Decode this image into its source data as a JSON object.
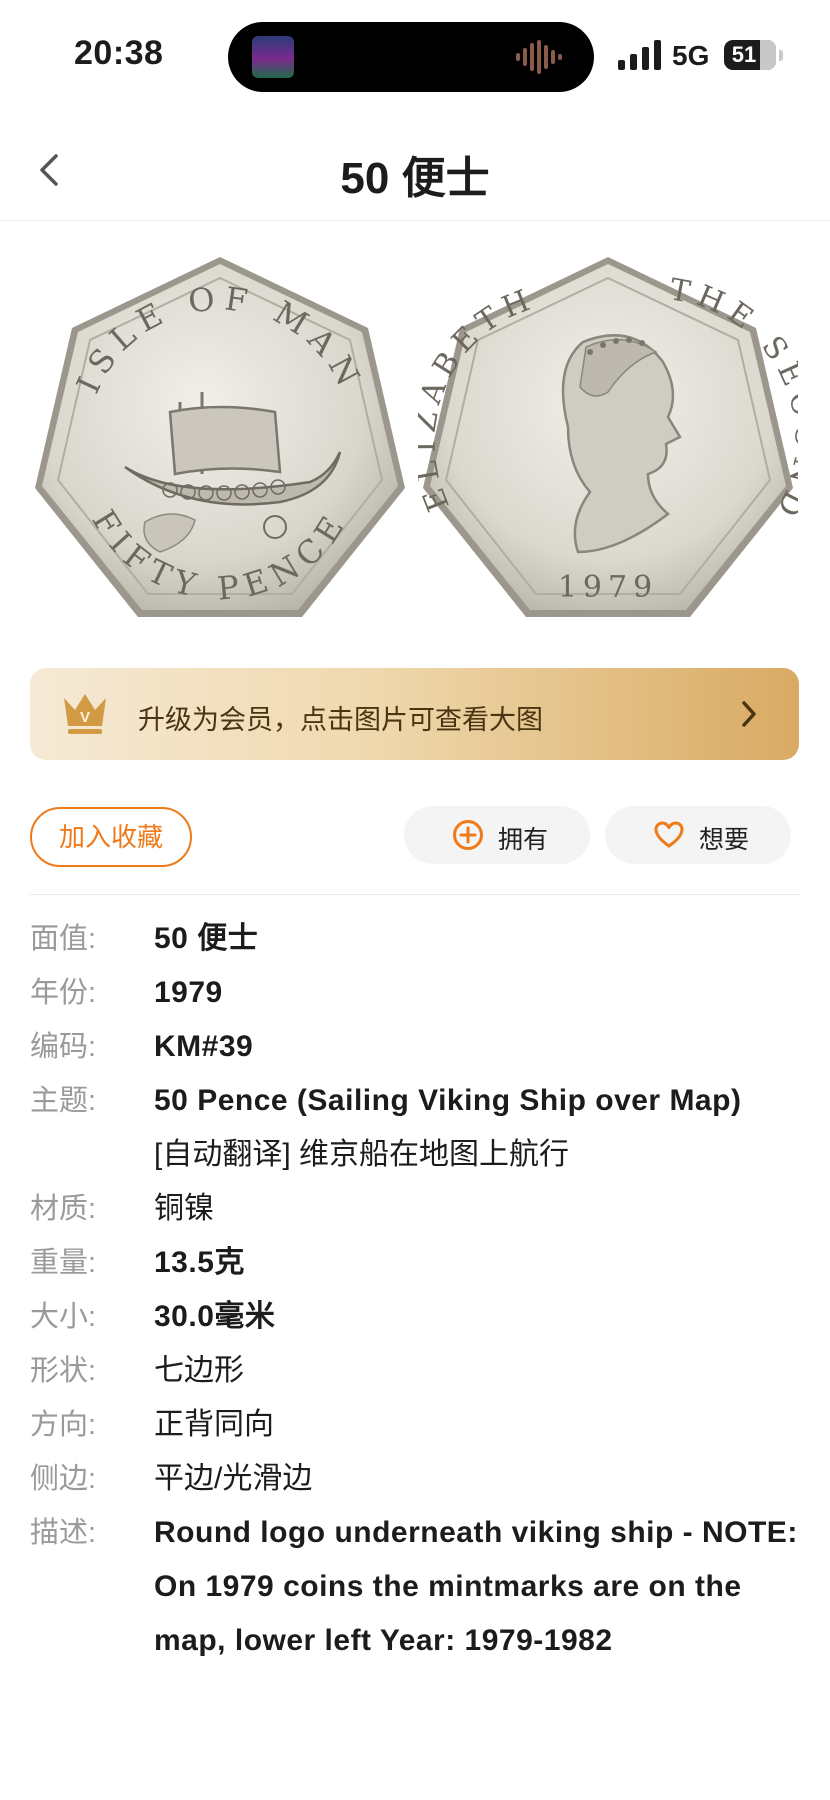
{
  "status_bar": {
    "time": "20:38",
    "network": "5G",
    "battery": "51"
  },
  "header": {
    "title": "50 便士",
    "back_icon": "chevron-left-icon"
  },
  "coin_images": {
    "obverse": {
      "top_text": "ISLE OF MAN",
      "bottom_text": "FIFTY PENCE"
    },
    "reverse": {
      "left_text": "ELIZABETH",
      "right_text": "THE SECOND",
      "year_text": "1979"
    }
  },
  "vip_banner": {
    "text": "升级为会员，点击图片可查看大图",
    "icon": "crown-icon",
    "badge_letter": "V"
  },
  "actions": {
    "collect_label": "加入收藏",
    "own_label": "拥有",
    "want_label": "想要"
  },
  "colors": {
    "accent": "#ef7a1a",
    "label_gray": "#9a9a9a",
    "banner_gold": "#d9aa63"
  },
  "details": {
    "denomination": {
      "label": "面值:",
      "value": "50 便士"
    },
    "year": {
      "label": "年份:",
      "value": "1979"
    },
    "code": {
      "label": "编码:",
      "value": "KM#39"
    },
    "subject": {
      "label": "主题:",
      "value": "50 Pence (Sailing Viking Ship over Map)",
      "translation": "[自动翻译] 维京船在地图上航行"
    },
    "material": {
      "label": "材质:",
      "value": "铜镍"
    },
    "weight": {
      "label": "重量:",
      "value": "13.5克"
    },
    "size": {
      "label": "大小:",
      "value": "30.0毫米"
    },
    "shape": {
      "label": "形状:",
      "value": "七边形"
    },
    "orientation": {
      "label": "方向:",
      "value": "正背同向"
    },
    "edge": {
      "label": "侧边:",
      "value": "平边/光滑边"
    },
    "description": {
      "label": "描述:",
      "value": "Round logo underneath viking ship - NOTE: On 1979 coins the mintmarks are on the map, lower left Year: 1979-1982"
    }
  }
}
